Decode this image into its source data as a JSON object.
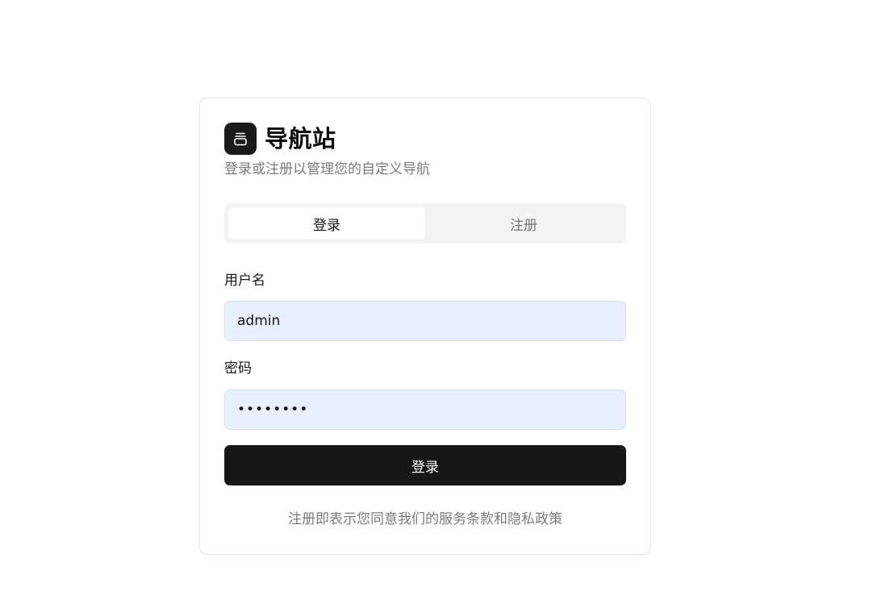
{
  "brand": {
    "title": "导航站",
    "logo_icon": "app-logo-icon",
    "subtitle": "登录或注册以管理您的自定义导航"
  },
  "tabs": [
    {
      "label": "登录",
      "active": true
    },
    {
      "label": "注册",
      "active": false
    }
  ],
  "form": {
    "username": {
      "label": "用户名",
      "value": "admin",
      "placeholder": ""
    },
    "password": {
      "label": "密码",
      "value": "••••••••",
      "placeholder": ""
    },
    "submit_label": "登录"
  },
  "footer": {
    "note": "注册即表示您同意我们的服务条款和隐私政策"
  },
  "colors": {
    "primary": "#171717",
    "input_autofill": "#e8f0fe",
    "muted_text": "#7a7a7a",
    "tab_track": "#f4f4f5"
  }
}
